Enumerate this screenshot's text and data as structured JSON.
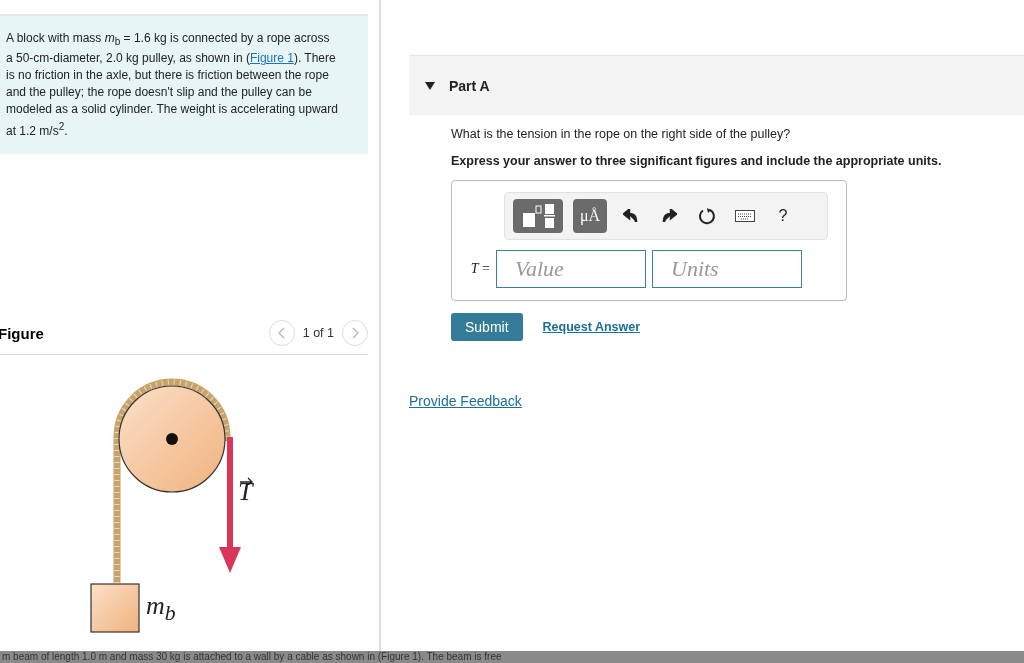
{
  "problem": {
    "before": "A block with mass *m*$_{b}$ = 1.6 kg is connected by a rope across a 50-cm-diameter, 2.0 kg pulley, as shown in (",
    "link": "Figure 1",
    "after": "). There is no friction in the axle, but there is friction between the rope and the pulley; the rope doesn't slip and the pulley can be modeled as a solid cylinder. The weight is accelerating upward at 1.2 m/s$^{2}$."
  },
  "figure": {
    "title": "Figure",
    "pager": "1 of 1",
    "prev_disabled": true,
    "next_disabled": true,
    "tension_label": "T",
    "mass_label": "*m*$_{b}$"
  },
  "part": {
    "title": "Part A",
    "expanded": true,
    "question": "What is the tension in the rope on the right side of the pulley?",
    "instruction": "Express your answer to three significant figures and include the appropriate units.",
    "toolbar": {
      "units_button": "μÅ",
      "help": "?"
    },
    "variable": "*T* =",
    "value_placeholder": "Value",
    "units_placeholder": "Units",
    "submit": "Submit",
    "request": "Request Answer"
  },
  "feedback": "Provide Feedback",
  "bottom_strip": "m beam of length 1.0 m and mass 30 kg is attached to a wall by a cable as shown in (Figure 1). The beam is free"
}
